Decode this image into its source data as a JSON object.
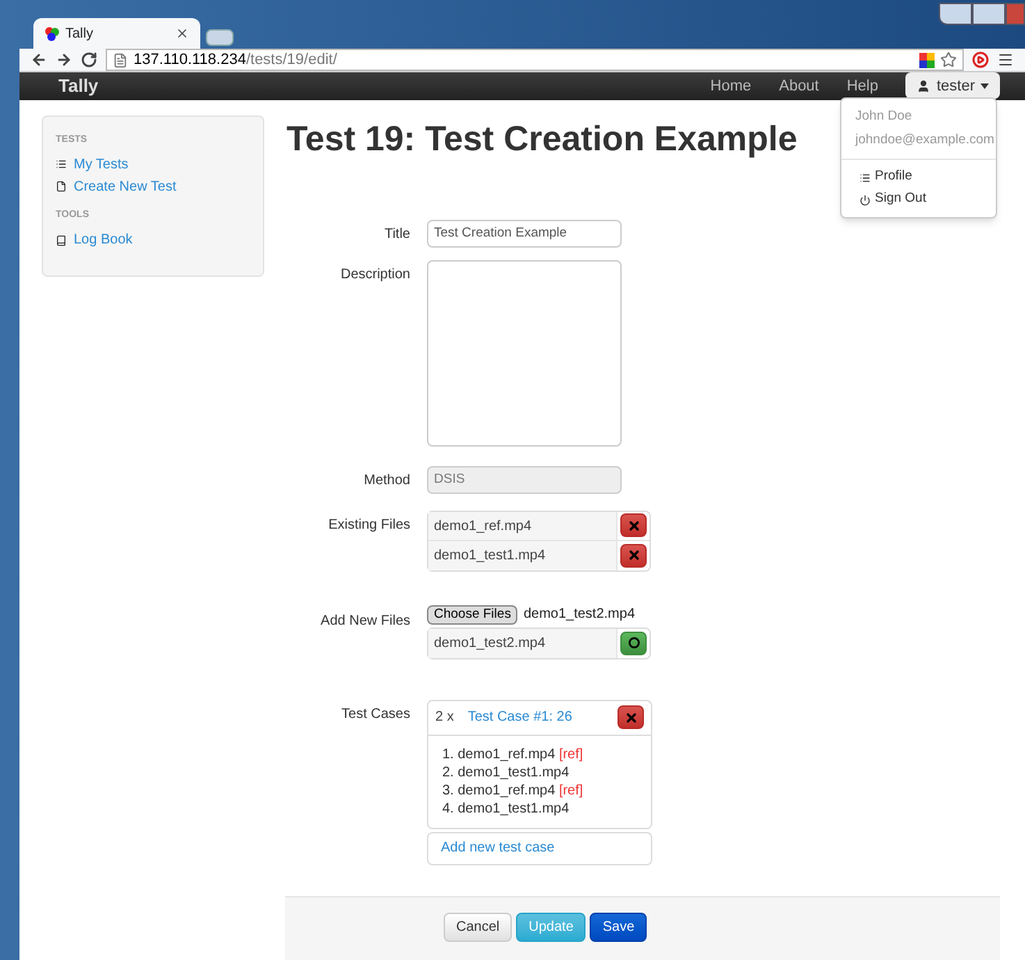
{
  "browser": {
    "tab_title": "Tally",
    "url_host": "137.110.118.234",
    "url_path": "/tests/19/edit/"
  },
  "navbar": {
    "brand": "Tally",
    "links": [
      "Home",
      "About",
      "Help"
    ],
    "user_button": "tester"
  },
  "user_menu": {
    "expanded": true,
    "name": "John Doe",
    "email": "johndoe@example.com",
    "items": [
      {
        "kind": "list",
        "label": "Profile"
      },
      {
        "kind": "power",
        "label": "Sign Out"
      }
    ]
  },
  "sidebar": {
    "sections": [
      {
        "header": "TESTS",
        "items": [
          {
            "kind": "list",
            "label": "My Tests"
          },
          {
            "kind": "file",
            "label": "Create New Test"
          }
        ]
      },
      {
        "header": "TOOLS",
        "items": [
          {
            "kind": "book",
            "label": "Log Book"
          }
        ]
      }
    ]
  },
  "page_title": "Test 19: Test Creation Example",
  "form": {
    "title_label": "Title",
    "title_value": "Test Creation Example",
    "description_label": "Description",
    "method_label": "Method",
    "method_value": "DSIS",
    "method_disabled": true,
    "existing_files_label": "Existing Files",
    "existing_files": [
      "demo1_ref.mp4",
      "demo1_test1.mp4"
    ],
    "add_files_label": "Add New Files",
    "choose_files_button": "Choose Files",
    "chosen_files": "demo1_test2.mp4",
    "new_files": [
      "demo1_test2.mp4"
    ],
    "test_cases_label": "Test Cases",
    "test_cases": [
      {
        "count": "2 x",
        "title": "Test Case #1: 26",
        "items": [
          {
            "number": "1.",
            "file": "demo1_ref.mp4",
            "tag": "[ref]"
          },
          {
            "number": "2.",
            "file": "demo1_test1.mp4"
          },
          {
            "number": "3.",
            "file": "demo1_ref.mp4",
            "tag": "[ref]"
          },
          {
            "number": "4.",
            "file": "demo1_test1.mp4"
          }
        ]
      }
    ],
    "add_test_case": "Add new test case"
  },
  "buttons": [
    {
      "kind": "default",
      "label": "Cancel"
    },
    {
      "kind": "info",
      "label": "Update"
    },
    {
      "kind": "primary",
      "label": "Save"
    }
  ]
}
